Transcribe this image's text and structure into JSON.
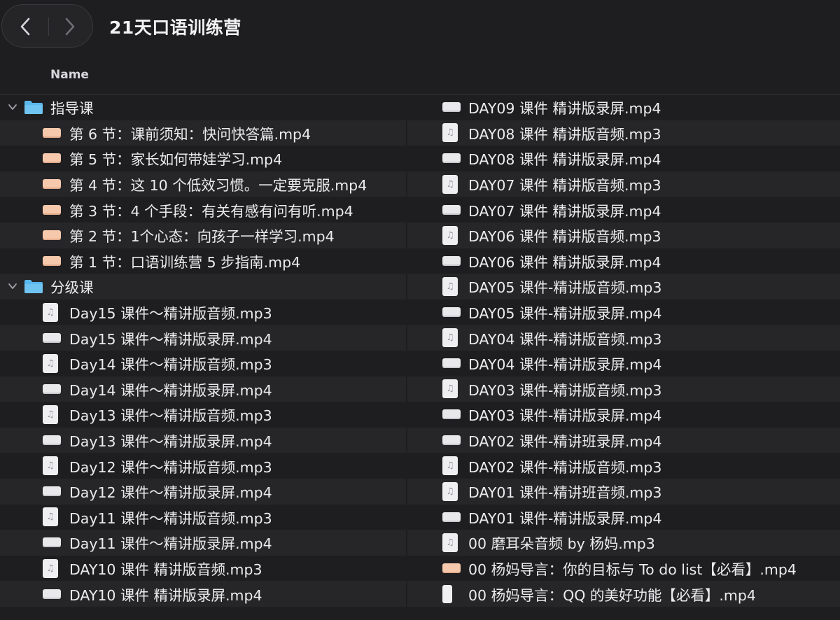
{
  "window": {
    "title": "21天口语训练营"
  },
  "header": {
    "name_column": "Name"
  },
  "icons": {
    "back": "chevron-left-icon",
    "forward": "chevron-right-icon",
    "folder": "folder-icon",
    "audio": "audio-file-icon",
    "video": "video-file-icon",
    "disclosure": "chevron-down-icon"
  },
  "colors": {
    "folder": "#5ab8ec",
    "video_peach": "#f6c9ad",
    "background": "#1e1e20",
    "row_alt": "#262629"
  },
  "left_column": [
    {
      "type": "folder",
      "label": "指导课",
      "expanded": true
    },
    {
      "type": "video-peach",
      "label": "第 6 节：课前须知：快问快答篇.mp4"
    },
    {
      "type": "video-peach",
      "label": "第 5 节：家长如何带娃学习.mp4"
    },
    {
      "type": "video-peach",
      "label": "第 4 节：这 10 个低效习惯。一定要克服.mp4"
    },
    {
      "type": "video-peach",
      "label": "第 3 节：4 个手段：有关有感有问有听.mp4"
    },
    {
      "type": "video-peach",
      "label": "第 2 节：1个心态：向孩子一样学习.mp4"
    },
    {
      "type": "video-peach",
      "label": "第 1 节：口语训练营 5 步指南.mp4"
    },
    {
      "type": "folder",
      "label": "分级课",
      "expanded": true
    },
    {
      "type": "audio",
      "label": "Day15 课件～精讲版音频.mp3"
    },
    {
      "type": "video",
      "label": "Day15 课件～精讲版录屏.mp4"
    },
    {
      "type": "audio",
      "label": "Day14 课件～精讲版音频.mp3"
    },
    {
      "type": "video",
      "label": "Day14 课件～精讲版录屏.mp4"
    },
    {
      "type": "audio",
      "label": "Day13 课件～精讲版音频.mp3"
    },
    {
      "type": "video",
      "label": "Day13 课件～精讲版录屏.mp4"
    },
    {
      "type": "audio",
      "label": "Day12 课件～精讲版音频.mp3"
    },
    {
      "type": "video",
      "label": "Day12 课件～精讲版录屏.mp4"
    },
    {
      "type": "audio",
      "label": "Day11 课件～精讲版音频.mp3"
    },
    {
      "type": "video",
      "label": "Day11 课件～精讲版录屏.mp4"
    },
    {
      "type": "audio",
      "label": "DAY10 课件 精讲版音频.mp3"
    },
    {
      "type": "video",
      "label": "DAY10 课件 精讲版录屏.mp4"
    }
  ],
  "right_column": [
    {
      "type": "video",
      "label": "DAY09 课件 精讲版录屏.mp4"
    },
    {
      "type": "audio",
      "label": "DAY08 课件 精讲版音频.mp3"
    },
    {
      "type": "video",
      "label": "DAY08 课件 精讲版录屏.mp4"
    },
    {
      "type": "audio",
      "label": "DAY07 课件 精讲版音频.mp3"
    },
    {
      "type": "video",
      "label": "DAY07 课件 精讲版录屏.mp4"
    },
    {
      "type": "audio",
      "label": "DAY06 课件 精讲版音频.mp3"
    },
    {
      "type": "video",
      "label": "DAY06 课件 精讲版录屏.mp4"
    },
    {
      "type": "audio",
      "label": "DAY05 课件-精讲版音频.mp3"
    },
    {
      "type": "video",
      "label": "DAY05 课件-精讲版录屏.mp4"
    },
    {
      "type": "audio",
      "label": "DAY04 课件-精讲版音频.mp3"
    },
    {
      "type": "video",
      "label": "DAY04 课件-精讲版录屏.mp4"
    },
    {
      "type": "audio",
      "label": "DAY03 课件-精讲版音频.mp3"
    },
    {
      "type": "video",
      "label": "DAY03 课件-精讲版录屏.mp4"
    },
    {
      "type": "video",
      "label": "DAY02 课件-精讲班录屏.mp4"
    },
    {
      "type": "audio",
      "label": "DAY02 课件-精讲版音频.mp3"
    },
    {
      "type": "audio",
      "label": "DAY01 课件-精讲班音频.mp3"
    },
    {
      "type": "video",
      "label": "DAY01 课件-精讲版录屏.mp4"
    },
    {
      "type": "audio",
      "label": "00 磨耳朵音频 by 杨妈.mp3"
    },
    {
      "type": "video-peach",
      "label": "00 杨妈导言：你的目标与 To do list【必看】.mp4"
    },
    {
      "type": "phone",
      "label": "00 杨妈导言：QQ 的美好功能【必看】.mp4"
    }
  ]
}
